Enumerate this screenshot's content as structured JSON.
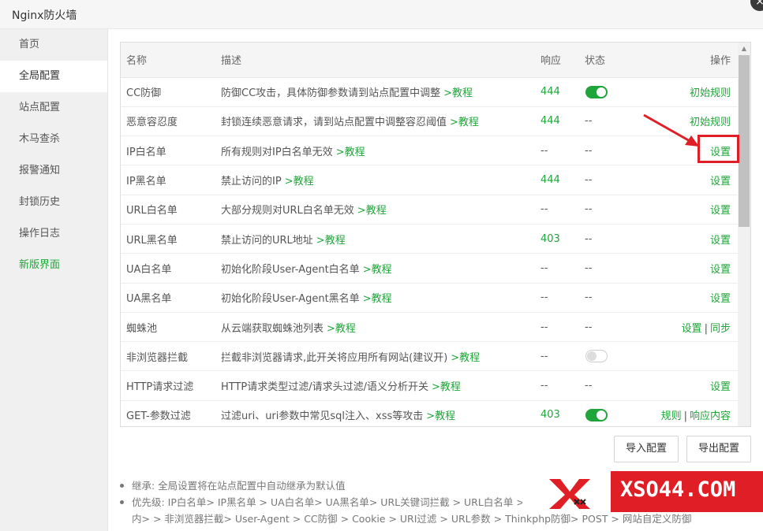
{
  "window": {
    "title": "Nginx防火墙",
    "close_glyph": "×"
  },
  "sidebar": {
    "items": [
      {
        "label": "首页"
      },
      {
        "label": "全局配置"
      },
      {
        "label": "站点配置"
      },
      {
        "label": "木马查杀"
      },
      {
        "label": "报警通知"
      },
      {
        "label": "封锁历史"
      },
      {
        "label": "操作日志"
      },
      {
        "label": "新版界面"
      }
    ]
  },
  "table": {
    "headers": {
      "name": "名称",
      "desc": "描述",
      "resp": "响应",
      "state": "状态",
      "op": "操作"
    },
    "tutorial_label": ">教程",
    "rows": [
      {
        "name": "CC防御",
        "desc": "防御CC攻击，具体防御参数请到站点配置中调整",
        "resp": "444",
        "state": "on",
        "ops": [
          "初始规则"
        ]
      },
      {
        "name": "恶意容忍度",
        "desc": "封锁连续恶意请求，请到站点配置中调整容忍阈值",
        "resp": "444",
        "state": "--",
        "ops": [
          "初始规则"
        ]
      },
      {
        "name": "IP白名单",
        "desc": "所有规则对IP白名单无效",
        "resp": "--",
        "state": "--",
        "ops": [
          "设置"
        ]
      },
      {
        "name": "IP黑名单",
        "desc": "禁止访问的IP",
        "resp": "444",
        "state": "--",
        "ops": [
          "设置"
        ]
      },
      {
        "name": "URL白名单",
        "desc": "大部分规则对URL白名单无效",
        "resp": "--",
        "state": "--",
        "ops": [
          "设置"
        ]
      },
      {
        "name": "URL黑名单",
        "desc": "禁止访问的URL地址",
        "resp": "403",
        "state": "--",
        "ops": [
          "设置"
        ]
      },
      {
        "name": "UA白名单",
        "desc": "初始化阶段User-Agent白名单",
        "resp": "--",
        "state": "--",
        "ops": [
          "设置"
        ]
      },
      {
        "name": "UA黑名单",
        "desc": "初始化阶段User-Agent黑名单",
        "resp": "--",
        "state": "--",
        "ops": [
          "设置"
        ]
      },
      {
        "name": "蜘蛛池",
        "desc": "从云端获取蜘蛛池列表",
        "resp": "--",
        "state": "--",
        "ops": [
          "设置",
          "同步"
        ]
      },
      {
        "name": "非浏览器拦截",
        "desc": "拦截非浏览器请求,此开关将应用所有网站(建议开)",
        "resp": "--",
        "state": "off",
        "ops": []
      },
      {
        "name": "HTTP请求过滤",
        "desc": "HTTP请求类型过滤/请求头过滤/语义分析开关",
        "resp": "--",
        "state": "--",
        "ops": [
          "设置"
        ]
      },
      {
        "name": "GET-参数过滤",
        "desc": "过滤uri、uri参数中常见sql注入、xss等攻击",
        "resp": "403",
        "state": "on",
        "ops": [
          "规则",
          "响应内容"
        ]
      }
    ]
  },
  "buttons": {
    "import": "导入配置",
    "export": "导出配置"
  },
  "notes": {
    "line1": "继承: 全局设置将在站点配置中自动继承为默认值",
    "line2": "优先级: IP白名单> IP黑名单 > UA白名单> UA黑名单> URL关键词拦截 > URL白名单 > U",
    "line3": "内> > 非浏览器拦截> User-Agent > CC防御 > Cookie > URI过滤 > URL参数 > Thinkphp防御> POST > 网站自定义防御"
  },
  "watermark": {
    "text": "XSO44.COM"
  },
  "colors": {
    "accent": "#20a53a",
    "highlight": "#e01e25"
  }
}
